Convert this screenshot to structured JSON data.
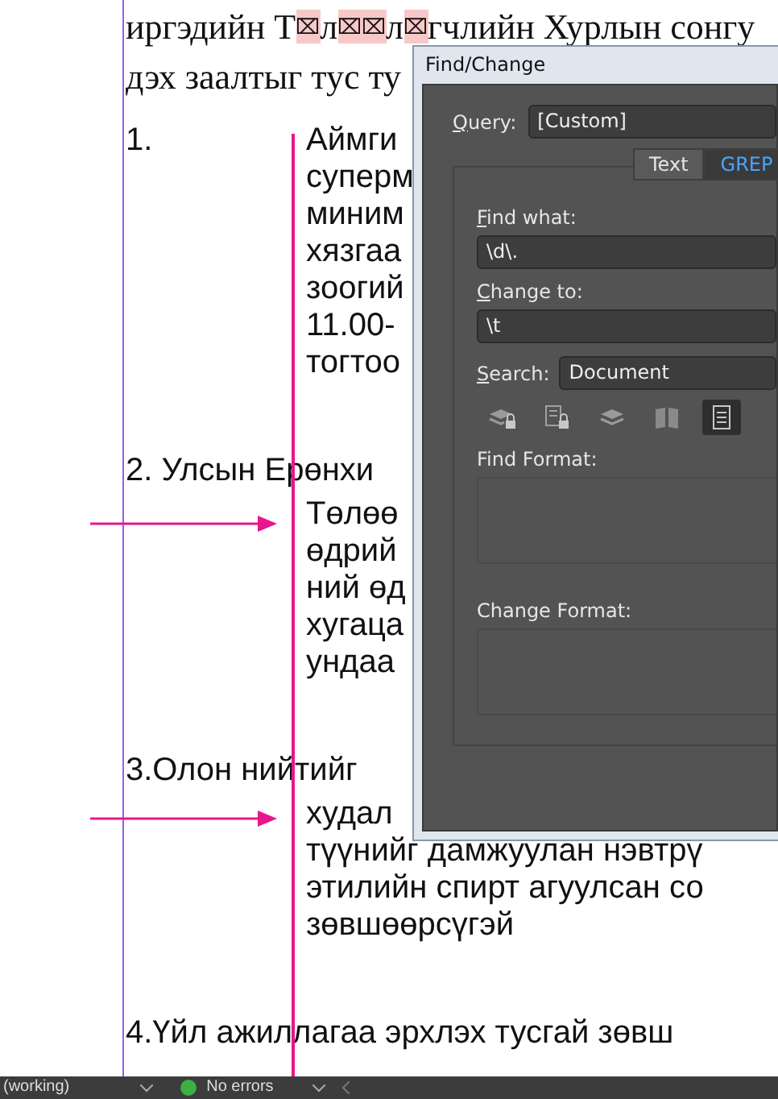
{
  "document": {
    "serif_lines": [
      [
        {
          "text": "иргэдийн Т",
          "missing": false
        },
        {
          "text": "⌧",
          "missing": true
        },
        {
          "text": "л",
          "missing": false
        },
        {
          "text": "⌧⌧",
          "missing": true
        },
        {
          "text": "л",
          "missing": false
        },
        {
          "text": "⌧",
          "missing": true
        },
        {
          "text": "гчлийн Хурлын сонгу",
          "missing": false
        }
      ],
      [
        {
          "text": "дэх заалтыг тус ту",
          "missing": false
        }
      ]
    ],
    "items": [
      {
        "rows": [
          {
            "kind": "tab",
            "marker": "1.",
            "text": "Аймги"
          },
          {
            "kind": "body",
            "text": "суперм"
          },
          {
            "kind": "body",
            "text": "миним"
          },
          {
            "kind": "body",
            "text": "хязгаа"
          },
          {
            "kind": "body",
            "text": "зоогий"
          },
          {
            "kind": "body",
            "text": "11.00-"
          },
          {
            "kind": "body",
            "text": "тогтоо"
          }
        ]
      },
      {
        "rows": [
          {
            "kind": "lead",
            "text": "2. Улсын Ерөнхи"
          },
          {
            "kind": "body",
            "text": "Төлөө"
          },
          {
            "kind": "body",
            "text": "өдрий"
          },
          {
            "kind": "body",
            "text": "ний өд"
          },
          {
            "kind": "body",
            "text": "хугаца"
          },
          {
            "kind": "body",
            "text": "ундаа"
          }
        ]
      },
      {
        "rows": [
          {
            "kind": "lead",
            "text": "3.Олон нийтийг"
          },
          {
            "kind": "body",
            "text": "худал"
          },
          {
            "kind": "body",
            "text": "түүнийг дамжуулан нэвтрү"
          },
          {
            "kind": "body",
            "text": "этилийн спирт агуулсан со"
          },
          {
            "kind": "body",
            "text": "зөвшөөрсүгэй"
          }
        ]
      },
      {
        "rows": [
          {
            "kind": "lead",
            "text": "4.Үйл ажиллагаа эрхлэх тусгай зөвш"
          }
        ]
      }
    ]
  },
  "dialog": {
    "title": "Find/Change",
    "query": {
      "label": "Query:",
      "mnemonic": true,
      "value": "[Custom]"
    },
    "tabs": [
      {
        "label": "Text",
        "selected": false
      },
      {
        "label": "GREP",
        "selected": true
      }
    ],
    "find_what": {
      "label": "Find what:",
      "mnemonic": true,
      "value": "\\d\\."
    },
    "change_to": {
      "label": "Change to:",
      "mnemonic": true,
      "value": "\\t"
    },
    "search": {
      "label": "Search:",
      "mnemonic": true,
      "value": "Document"
    },
    "options": [
      {
        "kind": "layers-lock",
        "selected": false
      },
      {
        "kind": "doc-lock",
        "selected": false
      },
      {
        "kind": "layers",
        "selected": false
      },
      {
        "kind": "book",
        "selected": false
      },
      {
        "kind": "page",
        "selected": true
      }
    ],
    "find_format": {
      "label": "Find Format:"
    },
    "change_format": {
      "label": "Change Format:"
    }
  },
  "status_bar": {
    "profile": "(working)",
    "status": "No errors"
  }
}
